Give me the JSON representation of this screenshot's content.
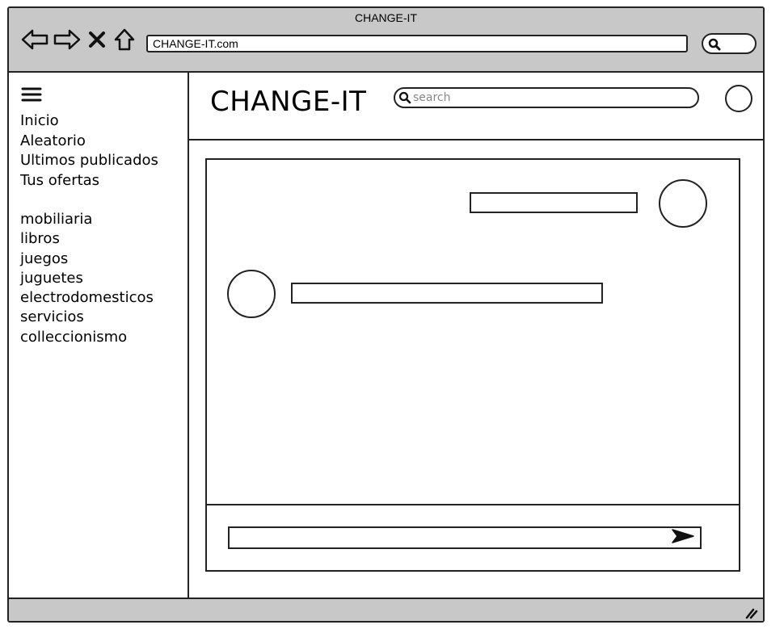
{
  "browser": {
    "window_title": "CHANGE-IT",
    "address": "CHANGE-IT.com",
    "icons": {
      "back": "back-arrow-icon",
      "forward": "forward-arrow-icon",
      "stop": "close-icon",
      "home": "home-icon",
      "search": "search-icon"
    }
  },
  "sidebar": {
    "menu_icon": "hamburger-icon",
    "nav_items": [
      {
        "label": "Inicio"
      },
      {
        "label": "Aleatorio"
      },
      {
        "label": "Ultimos publicados"
      },
      {
        "label": "Tus ofertas"
      }
    ],
    "categories": [
      {
        "label": "mobiliaria"
      },
      {
        "label": "libros"
      },
      {
        "label": "juegos"
      },
      {
        "label": "juguetes"
      },
      {
        "label": "electrodomesticos"
      },
      {
        "label": "servicios"
      },
      {
        "label": "colleccionismo"
      }
    ]
  },
  "header": {
    "brand": "CHANGE-IT",
    "search_placeholder": "search",
    "avatar_icon": "user-avatar"
  },
  "chat": {
    "messages": [
      {
        "side": "right",
        "text": ""
      },
      {
        "side": "left",
        "text": ""
      }
    ],
    "composer_placeholder": "",
    "send_icon": "send-icon"
  }
}
